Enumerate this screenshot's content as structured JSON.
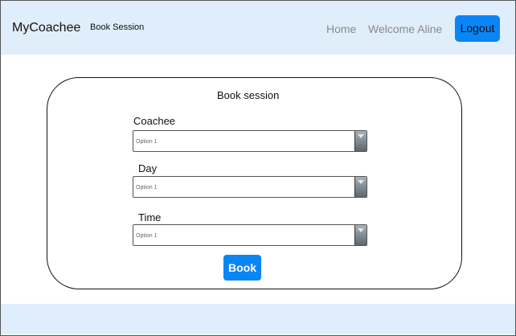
{
  "header": {
    "brand": "MyCoachee",
    "nav_book_session": "Book Session",
    "nav_home": "Home",
    "welcome_text": "Welcome Aline",
    "logout_label": "Logout"
  },
  "form": {
    "title": "Book session",
    "fields": [
      {
        "label": "Coachee",
        "value": "Option 1"
      },
      {
        "label": "Day",
        "value": "Option 1"
      },
      {
        "label": "Time",
        "value": "Option 1"
      }
    ],
    "submit_label": "Book"
  },
  "colors": {
    "header_bg": "#dfeefa",
    "accent": "#0a85f5"
  }
}
